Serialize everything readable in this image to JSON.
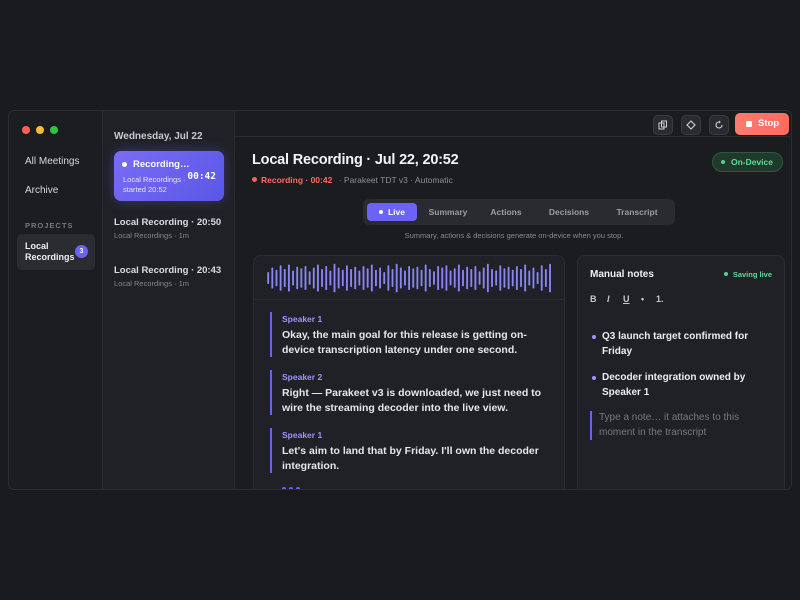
{
  "sidebar": {
    "nav": [
      {
        "label": "All Meetings"
      },
      {
        "label": "Archive"
      }
    ],
    "section_label": "PROJECTS",
    "project": {
      "label": "Local Recordings",
      "badge": "3"
    }
  },
  "meeting_list": {
    "date_header": "Wednesday, Jul 22",
    "active": {
      "title": "Recording…",
      "subtitle": "Local Recordings · started 20:52",
      "timer": "00:42"
    },
    "items": [
      {
        "title": "Local Recording · 20:50",
        "subtitle": "Local Recordings · 1m"
      },
      {
        "title": "Local Recording · 20:43",
        "subtitle": "Local Recordings · 1m"
      }
    ]
  },
  "toolbar": {
    "stop_label": "Stop",
    "icons": [
      "copy-icon",
      "pin-icon",
      "refresh-icon"
    ]
  },
  "header": {
    "title": "Local Recording · Jul 22, 20:52",
    "status": "Recording · 00:42",
    "model": "· Parakeet TDT v3 · Automatic",
    "badge": "On-Device"
  },
  "tabs": [
    {
      "label": "Live",
      "active": true
    },
    {
      "label": "Summary"
    },
    {
      "label": "Actions"
    },
    {
      "label": "Decisions"
    },
    {
      "label": "Transcript"
    }
  ],
  "hint": "Summary, actions & decisions generate on-device when you stop.",
  "waveform": {
    "color": "#8a84f7",
    "levels": [
      0.4,
      0.7,
      0.55,
      0.85,
      0.6,
      0.9,
      0.5,
      0.75,
      0.65,
      0.8,
      0.45,
      0.7,
      0.9,
      0.6,
      0.8,
      0.5,
      0.95,
      0.7,
      0.55,
      0.85,
      0.6,
      0.75,
      0.5,
      0.8,
      0.65,
      0.9,
      0.55,
      0.7,
      0.4,
      0.85,
      0.6,
      0.95,
      0.7,
      0.5,
      0.8,
      0.65,
      0.75,
      0.55,
      0.9,
      0.6,
      0.45,
      0.8,
      0.7,
      0.85,
      0.5,
      0.65,
      0.9,
      0.55,
      0.75,
      0.6,
      0.8,
      0.45,
      0.7,
      0.95,
      0.6,
      0.5,
      0.85,
      0.65,
      0.75,
      0.55,
      0.8,
      0.6,
      0.9,
      0.5,
      0.7,
      0.4,
      0.85,
      0.6,
      0.95
    ]
  },
  "transcript": [
    {
      "speaker": "Speaker 1",
      "text": "Okay, the main goal for this release is getting on-device transcription latency under one second."
    },
    {
      "speaker": "Speaker 2",
      "text": "Right — Parakeet v3 is downloaded, we just need to wire the streaming decoder into the live view."
    },
    {
      "speaker": "Speaker 1",
      "text": "Let's aim to land that by Friday. I'll own the decoder integration."
    }
  ],
  "notes": {
    "title": "Manual notes",
    "status": "Saving live",
    "format": [
      "B",
      "I",
      "U",
      "•",
      "1."
    ],
    "bullets": [
      "Q3 launch target confirmed for Friday",
      "Decoder integration owned by Speaker 1"
    ],
    "placeholder": "Type a note… it attaches to this moment in the transcript"
  },
  "colors": {
    "accent": "#6a63f5",
    "stop": "#ff6a5e",
    "live_green": "#5fdc94"
  }
}
